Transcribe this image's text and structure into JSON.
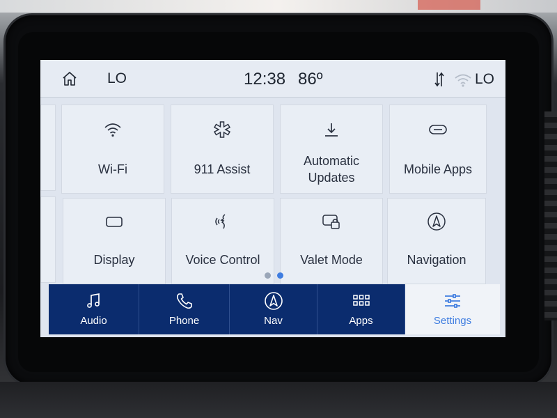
{
  "statusbar": {
    "home_icon": "home-icon",
    "left_fan_label": "LO",
    "time": "12:38",
    "temperature": "86º",
    "data_transfer_icon": "data-transfer-icon",
    "wifi_icon": "wifi-icon",
    "right_fan_label": "LO"
  },
  "tiles": [
    {
      "label": "Wi-Fi",
      "icon": "wifi-icon"
    },
    {
      "label": "911 Assist",
      "icon": "snowflake-star-icon"
    },
    {
      "label_line1": "Automatic",
      "label_line2": "Updates",
      "icon": "download-icon"
    },
    {
      "label": "Mobile Apps",
      "icon": "link-icon"
    },
    {
      "label": "Display",
      "icon": "display-icon"
    },
    {
      "label": "Voice Control",
      "icon": "voice-icon"
    },
    {
      "label": "Valet Mode",
      "icon": "valet-lock-icon"
    },
    {
      "label": "Navigation",
      "icon": "navigation-icon"
    }
  ],
  "pagination": {
    "pages": 2,
    "active_page": 2
  },
  "navbar": {
    "items": [
      {
        "label": "Audio",
        "icon": "music-note-icon"
      },
      {
        "label": "Phone",
        "icon": "phone-icon"
      },
      {
        "label": "Nav",
        "icon": "navigation-icon"
      },
      {
        "label": "Apps",
        "icon": "apps-grid-icon"
      },
      {
        "label": "Settings",
        "icon": "settings-sliders-icon",
        "active": true
      }
    ]
  },
  "colors": {
    "navbar_bg": "#0b2c6e",
    "active_tab_text": "#3f7de0",
    "screen_bg": "#dfe5ef",
    "dot_active": "#3f7de0",
    "dot_inactive": "#9aa6b8"
  }
}
